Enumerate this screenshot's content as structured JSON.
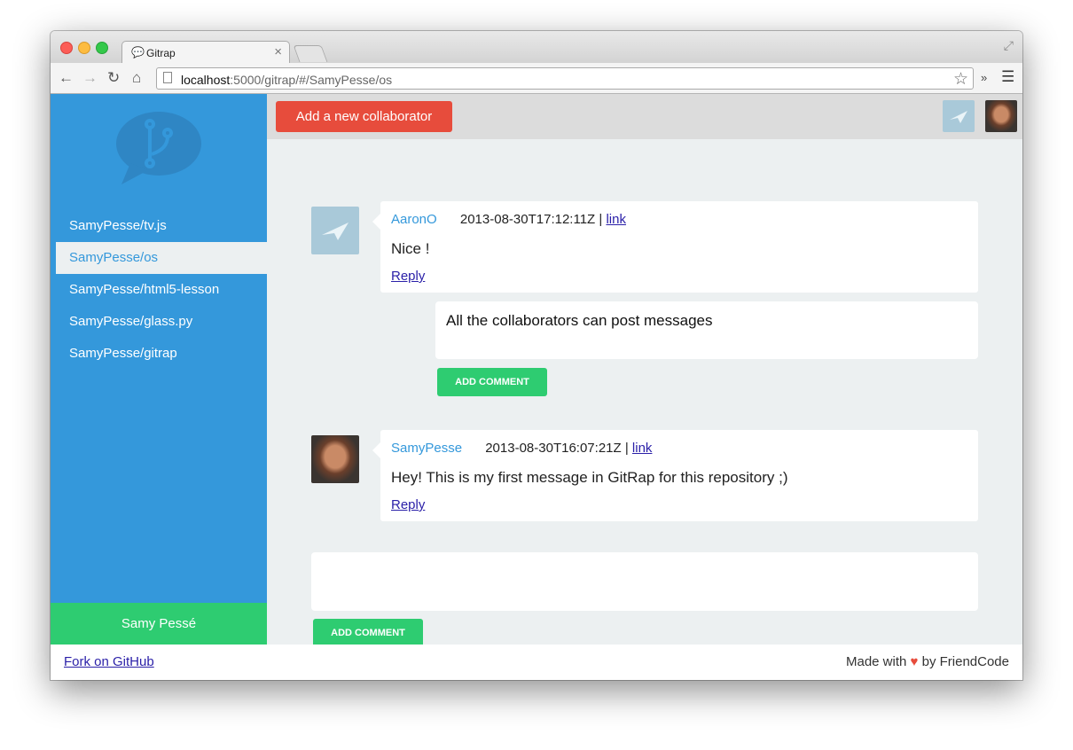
{
  "browser": {
    "tab_title": "Gitrap",
    "url_host": "localhost",
    "url_rest": ":5000/gitrap/#/SamyPesse/os"
  },
  "sidebar": {
    "repos": [
      {
        "label": "SamyPesse/tv.js"
      },
      {
        "label": "SamyPesse/os"
      },
      {
        "label": "SamyPesse/html5-lesson"
      },
      {
        "label": "SamyPesse/glass.py"
      },
      {
        "label": "SamyPesse/gitrap"
      }
    ],
    "active_index": 1,
    "user_name": "Samy Pessé"
  },
  "topbar": {
    "add_collaborator_label": "Add a new collaborator"
  },
  "comments": [
    {
      "author": "AaronO",
      "timestamp": "2013-08-30T17:12:11Z",
      "separator": "|",
      "link_label": "link",
      "body": "Nice !",
      "reply_label": "Reply"
    },
    {
      "author": "SamyPesse",
      "timestamp": "2013-08-30T16:07:21Z",
      "separator": "|",
      "link_label": "link",
      "body": "Hey! This is my first message in GitRap for this repository ;)",
      "reply_label": "Reply"
    }
  ],
  "reply_box": {
    "value": "All the collaborators can post messages",
    "button_label": "ADD COMMENT"
  },
  "new_comment_box": {
    "value": "",
    "button_label": "ADD COMMENT"
  },
  "footer": {
    "fork_label": "Fork on GitHub",
    "made_with_prefix": "Made with",
    "made_with_suffix": "by FriendCode"
  },
  "colors": {
    "sidebar": "#3498db",
    "accent_green": "#2ecc71",
    "accent_red": "#e74c3c",
    "main_bg": "#ecf0f1"
  },
  "icons": {
    "tab": "speech-bubble-icon",
    "logo": "git-branch-speech-bubble-logo",
    "heart": "heart-icon"
  }
}
